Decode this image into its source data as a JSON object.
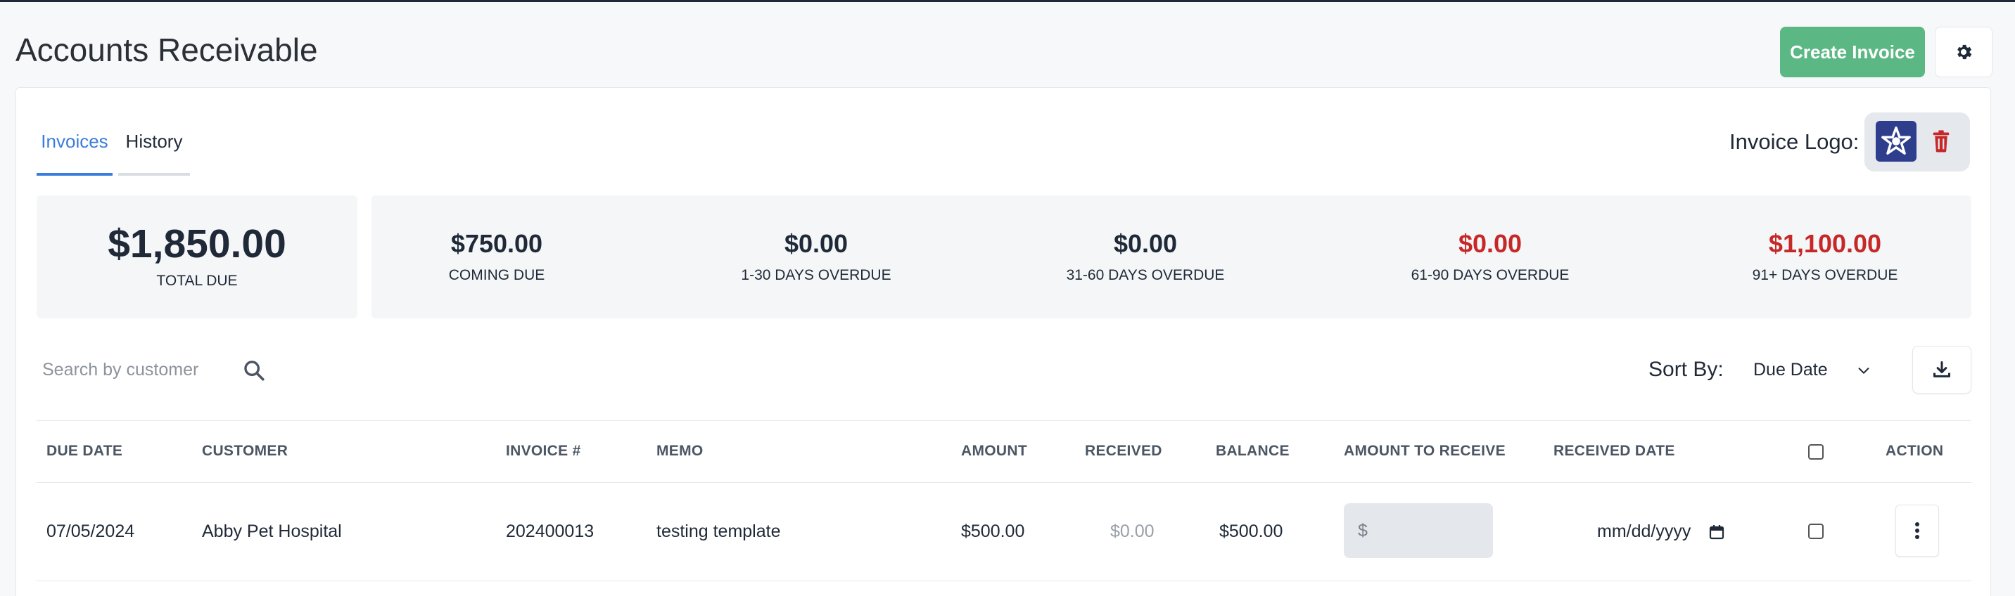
{
  "header": {
    "title": "Accounts Receivable",
    "create_label": "Create Invoice"
  },
  "tabs": [
    {
      "label": "Invoices",
      "active": true
    },
    {
      "label": "History",
      "active": false
    }
  ],
  "invoice_logo": {
    "label": "Invoice Logo:"
  },
  "summary": {
    "total_amount": "$1,850.00",
    "total_label": "TOTAL DUE",
    "aging": [
      {
        "amount": "$750.00",
        "label": "COMING DUE",
        "color": "#1f2937"
      },
      {
        "amount": "$0.00",
        "label": "1-30 DAYS OVERDUE",
        "color": "#1f2937"
      },
      {
        "amount": "$0.00",
        "label": "31-60 DAYS OVERDUE",
        "color": "#1f2937"
      },
      {
        "amount": "$0.00",
        "label": "61-90 DAYS OVERDUE",
        "color": "#c62828"
      },
      {
        "amount": "$1,100.00",
        "label": "91+ DAYS OVERDUE",
        "color": "#c62828"
      }
    ]
  },
  "search": {
    "placeholder": "Search by customer"
  },
  "sort": {
    "label": "Sort By:",
    "value": "Due Date"
  },
  "table": {
    "columns": [
      "DUE DATE",
      "CUSTOMER",
      "INVOICE #",
      "MEMO",
      "AMOUNT",
      "RECEIVED",
      "BALANCE",
      "AMOUNT TO RECEIVE",
      "RECEIVED DATE",
      "ACTION"
    ],
    "rows": [
      {
        "due_date": "07/05/2024",
        "customer": "Abby Pet Hospital",
        "invoice_no": "202400013",
        "memo": "testing template",
        "amount": "$500.00",
        "received": "$0.00",
        "balance": "$500.00",
        "amount_to_receive_prefix": "$",
        "received_date_placeholder": "mm/dd/yyyy"
      }
    ]
  },
  "colors": {
    "accent": "#3b7ddd",
    "create_button": "#5bb884",
    "overdue_red": "#c62828"
  }
}
